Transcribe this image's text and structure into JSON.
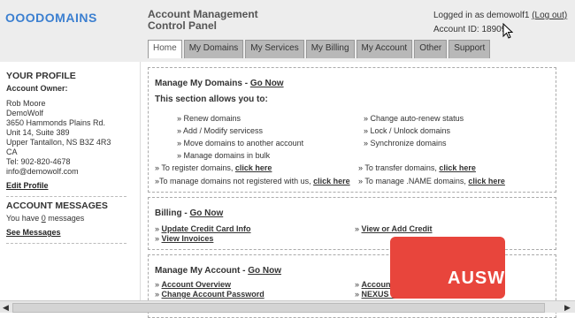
{
  "header": {
    "logo_prefix": "OOO",
    "logo_main": "DOMAINS",
    "title_line1": "Account Management",
    "title_line2": "Control Panel",
    "logged_in": "Logged in as demowolf1",
    "logout": "(Log out)",
    "account_id": "Account ID: 18909"
  },
  "tabs": [
    "Home",
    "My Domains",
    "My Services",
    "My Billing",
    "My Account",
    "Other",
    "Support"
  ],
  "sidebar": {
    "profile_heading": "YOUR PROFILE",
    "owner_label": "Account Owner:",
    "address": [
      "Rob Moore",
      "DemoWolf",
      "3650 Hammonds Plains Rd.",
      "Unit 14, Suite 389",
      "Upper Tantallon, NS B3Z 4R3",
      "CA",
      "Tel: 902-820-4678",
      "info@demowolf.com"
    ],
    "edit_profile": "Edit Profile",
    "messages_heading": "ACCOUNT MESSAGES",
    "messages_text": "You have ",
    "messages_count": "0",
    "messages_suffix": " messages",
    "see_messages": "See Messages"
  },
  "domains": {
    "heading": "Manage My Domains - ",
    "go": "Go Now",
    "intro": "This section allows you to:",
    "left_items": [
      "Renew domains",
      "Add / Modify servicess",
      "Move domains to another account",
      "Manage domains in bulk"
    ],
    "right_items": [
      "Change auto-renew status",
      "Lock / Unlock domains",
      "Synchronize domains"
    ],
    "register_text": "» To register domains, ",
    "register_link": "click here",
    "transfer_text": "» To transfer domains, ",
    "transfer_link": "click here",
    "manage_other_text": "»To manage domains not registered with us, ",
    "manage_other_link": "click here",
    "manage_name_text": "» To manage .NAME domains, ",
    "manage_name_link": "click here"
  },
  "billing": {
    "heading": "Billing - ",
    "go": "Go Now",
    "links_left": [
      "Update Credit Card Info",
      "View Invoices"
    ],
    "links_right": [
      "View or Add Credit"
    ]
  },
  "account": {
    "heading": "Manage My Account - ",
    "go": "Go Now",
    "links_left": [
      "Account Overview",
      "Change Account Password"
    ],
    "links_right": [
      "Account Messages",
      "NEXUS Information"
    ]
  },
  "watermark": "AUSWEB"
}
